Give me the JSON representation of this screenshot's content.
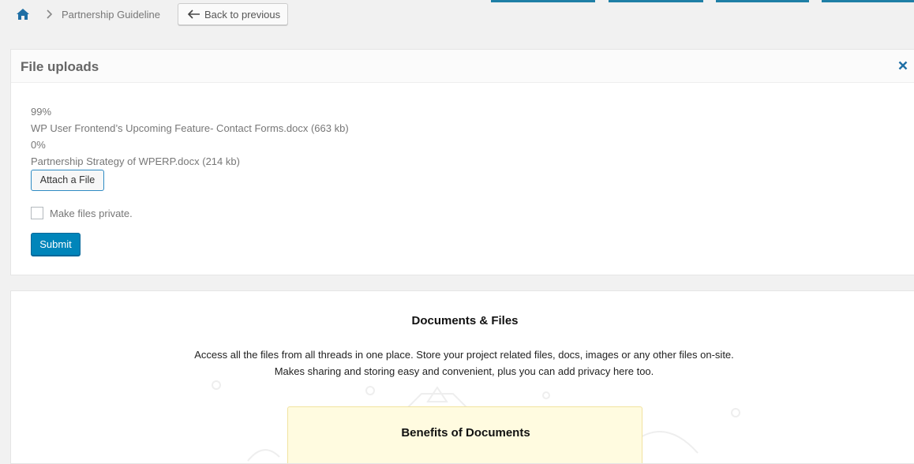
{
  "breadcrumb": {
    "home_icon": "home-icon",
    "separator_icon": "chevron-right-icon",
    "current": "Partnership Guideline",
    "back_label": "Back to previous",
    "back_icon": "arrow-left-icon"
  },
  "uploads": {
    "title": "File uploads",
    "close_icon": "close-icon",
    "files": [
      {
        "progress": "99%",
        "name": "WP User Frontend’s Upcoming Feature- Contact Forms.docx (663 kb)"
      },
      {
        "progress": "0%",
        "name": "Partnership Strategy of WPERP.docx (214 kb)"
      }
    ],
    "attach_label": "Attach a File",
    "private_label": "Make files private.",
    "private_checked": false,
    "submit_label": "Submit"
  },
  "docs": {
    "title": "Documents & Files",
    "description": "Access all the files from all threads in one place. Store your project related files, docs, images or any other files on-site. Makes sharing and storing easy and convenient, plus you can add privacy here too.",
    "benefits_title": "Benefits of Documents"
  },
  "colors": {
    "accent": "#0085ba",
    "link_icon": "#1f6fa5",
    "benefits_bg": "#fffbe0"
  }
}
